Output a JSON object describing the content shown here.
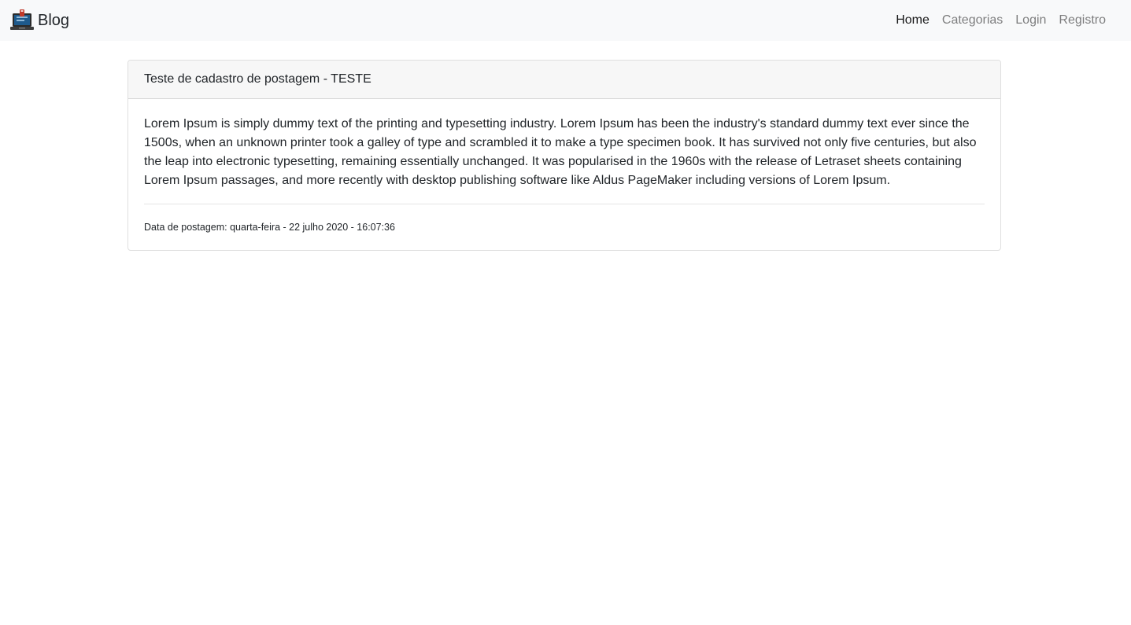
{
  "navbar": {
    "brand_text": "Blog",
    "brand_icon": "laptop-logo-icon",
    "links": [
      {
        "label": "Home",
        "active": true
      },
      {
        "label": "Categorias",
        "active": false
      },
      {
        "label": "Login",
        "active": false
      },
      {
        "label": "Registro",
        "active": false
      }
    ]
  },
  "post": {
    "title": "Teste de cadastro de postagem - TESTE",
    "content": "Lorem Ipsum is simply dummy text of the printing and typesetting industry. Lorem Ipsum has been the industry's standard dummy text ever since the 1500s, when an unknown printer took a galley of type and scrambled it to make a type specimen book. It has survived not only five centuries, but also the leap into electronic typesetting, remaining essentially unchanged. It was popularised in the 1960s with the release of Letraset sheets containing Lorem Ipsum passages, and more recently with desktop publishing software like Aldus PageMaker including versions of Lorem Ipsum.",
    "date_text": "Data de postagem: quarta-feira - 22 julho 2020 - 16:07:36"
  },
  "colors": {
    "navbar_bg": "#f8f9fa",
    "card_header_bg": "#f7f7f7",
    "logo_screen": "#1e5a8c",
    "logo_frame": "#2b2b2b"
  }
}
